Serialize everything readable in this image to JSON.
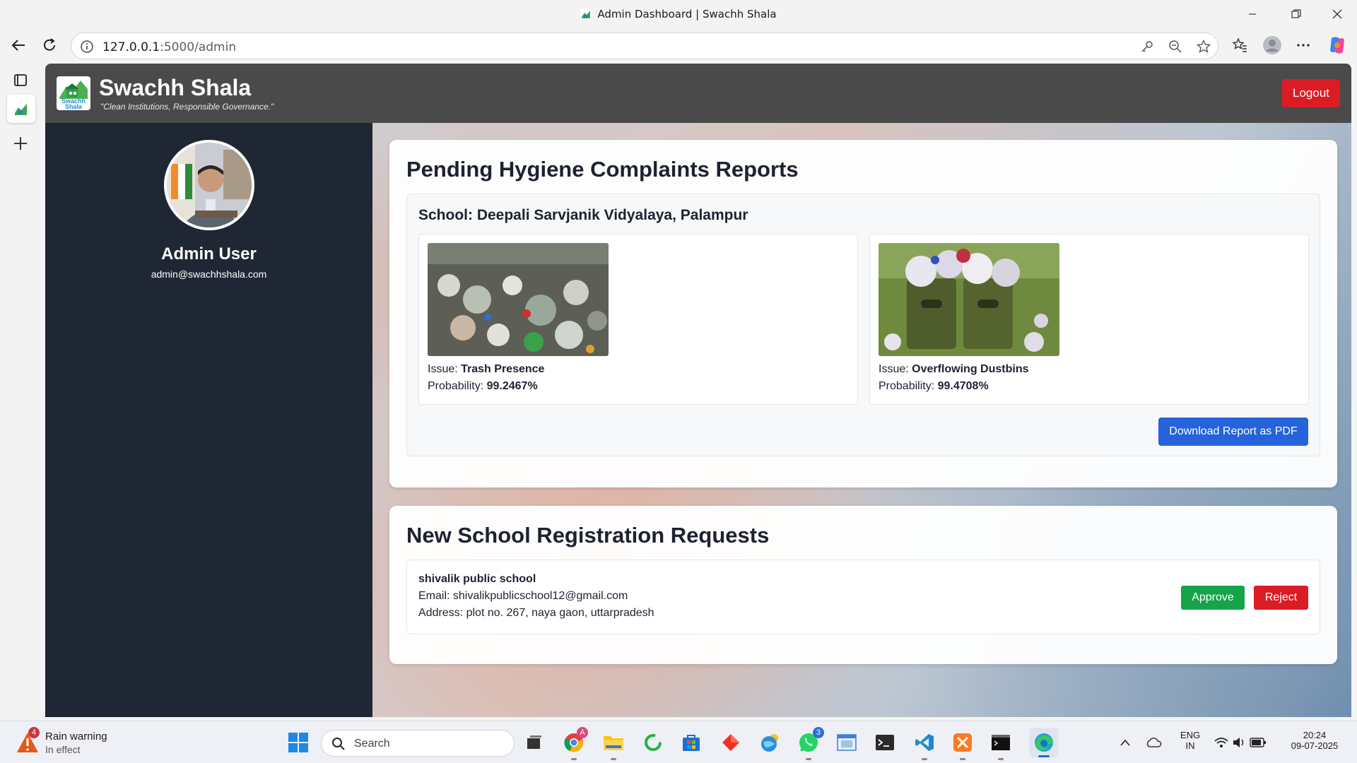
{
  "browser": {
    "window_title": "Admin Dashboard | Swachh Shala",
    "url_host": "127.0.0.1",
    "url_path": ":5000/admin"
  },
  "header": {
    "brand": "Swachh Shala",
    "tagline": "\"Clean Institutions, Responsible Governance.\"",
    "logo_text": "Swachh Shala",
    "logout_label": "Logout"
  },
  "sidebar": {
    "name": "Admin User",
    "email": "admin@swachhshala.com"
  },
  "complaints": {
    "heading": "Pending Hygiene Complaints Reports",
    "school": "School: Deepali Sarvjanik Vidyalaya, Palampur",
    "reports": [
      {
        "issue_label": "Issue:",
        "issue": "Trash Presence",
        "prob_label": "Probability:",
        "probability": "99.2467%"
      },
      {
        "issue_label": "Issue:",
        "issue": "Overflowing Dustbins",
        "prob_label": "Probability:",
        "probability": "99.4708%"
      }
    ],
    "download_label": "Download Report as PDF"
  },
  "registrations": {
    "heading": "New School Registration Requests",
    "requests": [
      {
        "name": "shivalik public school",
        "email_line": "Email: shivalikpublicschool12@gmail.com",
        "address_line": "Address: plot no. 267, naya gaon, uttarpradesh",
        "approve_label": "Approve",
        "reject_label": "Reject"
      }
    ]
  },
  "taskbar": {
    "weather_title": "Rain warning",
    "weather_sub": "In effect",
    "weather_badge": "4",
    "search_placeholder": "Search",
    "lang_top": "ENG",
    "lang_bottom": "IN",
    "time": "20:24",
    "date": "09-07-2025",
    "chrome_badge": "A",
    "whatsapp_badge": "3"
  },
  "colors": {
    "header_bg": "#4a4a4a",
    "sidebar_bg": "#1f2735",
    "logout": "#dc1c24",
    "download": "#2563db",
    "approve": "#16a34a",
    "reject": "#dc1c24"
  }
}
